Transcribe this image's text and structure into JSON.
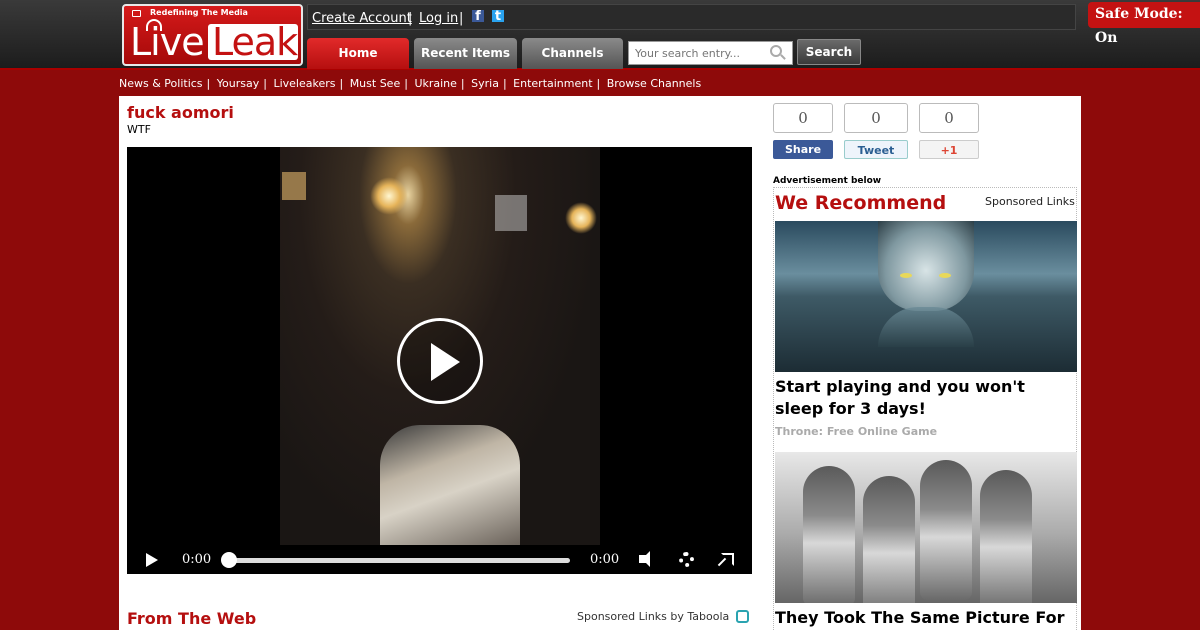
{
  "logo": {
    "tagline": "Redefining The Media",
    "live": "Live",
    "leak": "Leak"
  },
  "userbar": {
    "create_account": "Create Account",
    "login": "Log in",
    "separator": "|",
    "facebook_glyph": "f",
    "twitter_glyph": "t"
  },
  "safe_mode": "Safe Mode: On",
  "nav": {
    "home": "Home",
    "recent": "Recent Items",
    "channels": "Channels"
  },
  "search": {
    "placeholder": "Your search entry...",
    "button": "Search"
  },
  "subnav": [
    "News & Politics",
    "Yoursay",
    "Liveleakers",
    "Must See",
    "Ukraine",
    "Syria",
    "Entertainment",
    "Browse Channels"
  ],
  "video": {
    "title": "fuck aomori",
    "category": "WTF",
    "current_time": "0:00",
    "duration": "0:00",
    "progress": 0
  },
  "from_web": {
    "heading": "From The Web",
    "sponsored": "Sponsored Links by Taboola"
  },
  "share": {
    "facebook": {
      "count": "0",
      "label": "Share"
    },
    "twitter": {
      "count": "0",
      "label": "Tweet"
    },
    "gplus": {
      "count": "0",
      "label": "+1"
    }
  },
  "ads": {
    "label": "Advertisement below",
    "heading": "We Recommend",
    "sponsored": "Sponsored Links",
    "items": [
      {
        "title": "Start playing and you won't sleep for 3 days!",
        "source": "Throne: Free Online Game"
      },
      {
        "title": "They Took The Same Picture For"
      }
    ]
  },
  "colors": {
    "brand_red": "#b50f0f",
    "page_bg": "#8e0a0a",
    "facebook": "#3b5998",
    "twitter": "#2aa3ef"
  }
}
